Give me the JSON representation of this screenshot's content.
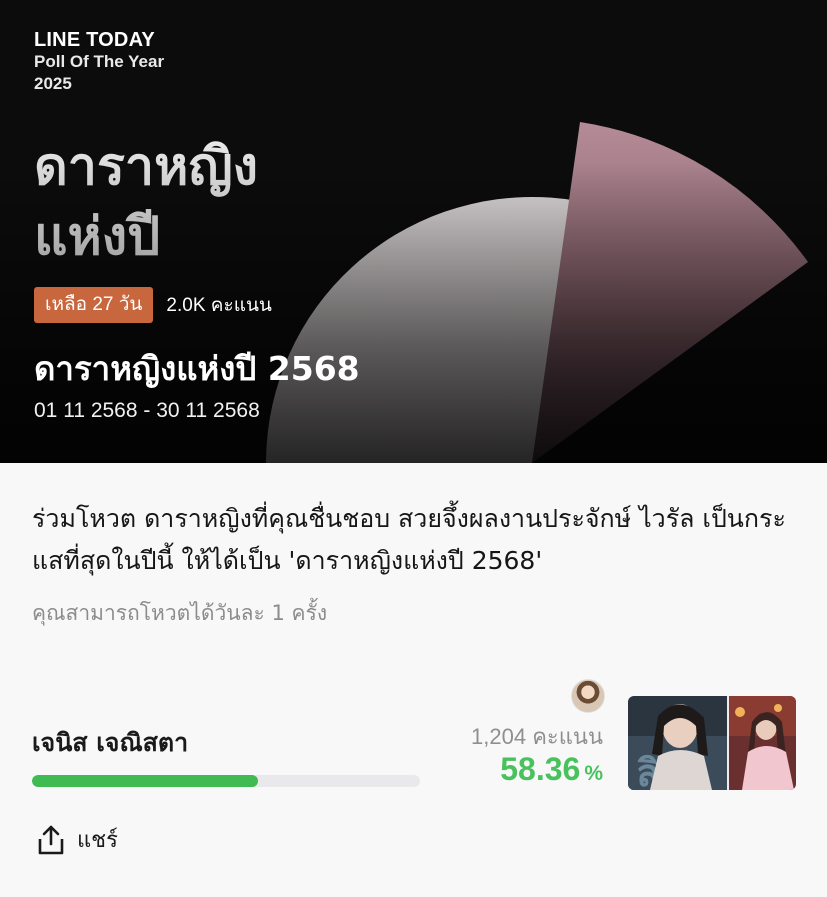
{
  "banner": {
    "brand_line1": "LINE TODAY",
    "brand_line2": "Poll Of The Year",
    "brand_line3": "2025",
    "big_title_line1": "ดาราหญิง",
    "big_title_line2": "แห่งปี",
    "colors": {
      "background": "#0c0c0c",
      "pie_main": "#d8d2d4",
      "pie_slice": "#a57c87",
      "badge": "#c8663e"
    }
  },
  "poll": {
    "days_left_badge": "เหลือ 27 วัน",
    "total_votes": "2.0K คะแนน",
    "title": "ดาราหญิงแห่งปี 2568",
    "date_range": "01 11 2568 - 30 11 2568",
    "description": "ร่วมโหวต ดาราหญิงที่คุณชื่นชอบ สวยจึ้งผลงานประจักษ์ ไวรัล เป็นกระแสที่สุดในปีนี้ ให้ได้เป็น 'ดาราหญิงแห่งปี 2568'",
    "vote_limit_note": "คุณสามารถโหวตได้วันละ 1 ครั้ง"
  },
  "candidates": [
    {
      "name": "เจนิส เจณิสตา",
      "votes": "1,204 คะแนน",
      "percent": "58.36",
      "percent_symbol": "%",
      "progress": 0.5836,
      "bar_color": "#3fbb51"
    }
  ],
  "actions": {
    "share_label": "แชร์",
    "share_icon": "share-icon"
  }
}
